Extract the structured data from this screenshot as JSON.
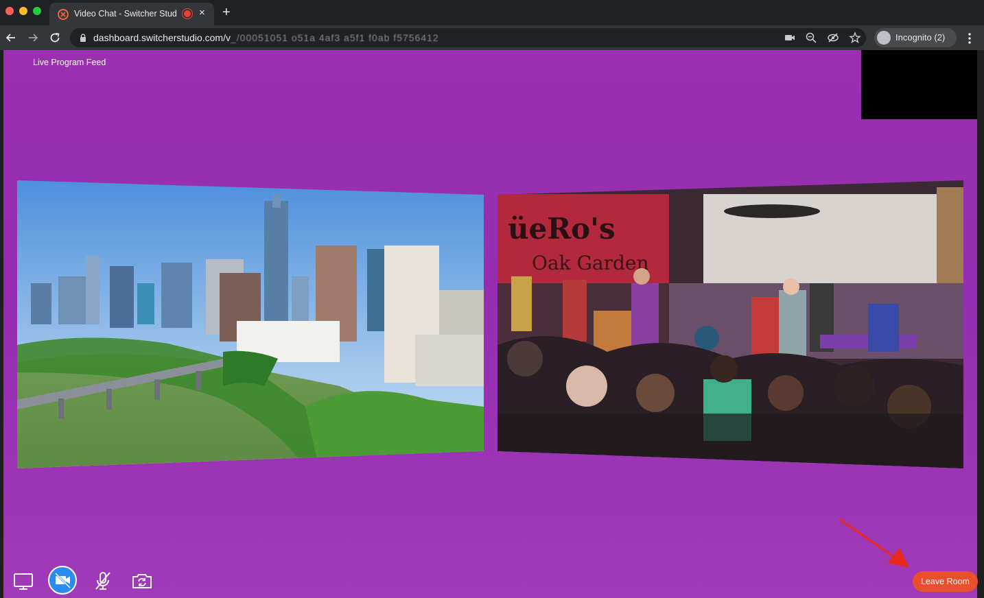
{
  "browser": {
    "tab": {
      "title": "Video Chat - Switcher Stud",
      "favicon": "switcher-logo-icon",
      "recording": "recording-indicator-icon",
      "close": "×"
    },
    "new_tab": "+",
    "url_visible": "dashboard.switcherstudio.com/v",
    "url_obscured": "_/00051051 o51a 4af3 a5f1 f0ab f5756412",
    "incognito_label": "Incognito (2)"
  },
  "room": {
    "feed_label": "Live Program Feed",
    "leave_label": "Leave Room",
    "controls": [
      "screen-share-icon",
      "video-off-icon",
      "mic-muted-icon",
      "camera-switch-icon"
    ]
  },
  "colors": {
    "background_purple": "#9a2fb0",
    "leave_button": "#e94f2f",
    "video_button": "#2d8ceb",
    "annotation_arrow": "#e8291c"
  }
}
